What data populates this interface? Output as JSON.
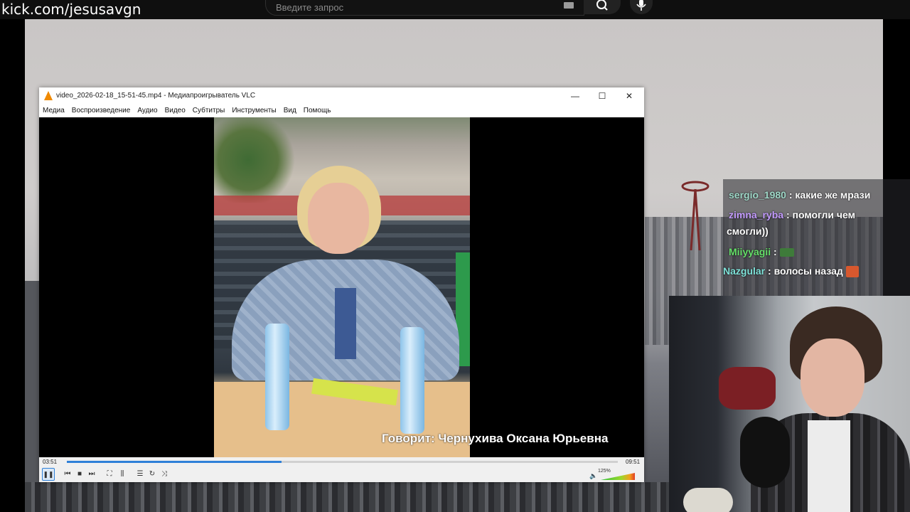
{
  "channel_url": "kick.com/jesusavgn",
  "search": {
    "placeholder": "Введите запрос"
  },
  "vlc": {
    "title": "video_2026-02-18_15-51-45.mp4 - Медиапроигрыватель VLC",
    "menu": [
      "Медиа",
      "Воспроизведение",
      "Аудио",
      "Видео",
      "Субтитры",
      "Инструменты",
      "Вид",
      "Помощь"
    ],
    "caption": "Говорит: Чернухива Оксана Юрьевна",
    "time_current": "03:51",
    "time_total": "09:51",
    "progress": 0.39,
    "volume": "125%",
    "window_buttons": {
      "minimize": "—",
      "maximize": "☐",
      "close": "✕"
    },
    "icons": {
      "play_pause": "pause-icon",
      "prev": "previous-icon",
      "stop": "stop-icon",
      "next": "next-icon",
      "fullscreen": "fullscreen-icon",
      "extended": "equalizer-icon",
      "playlist": "playlist-icon",
      "loop": "loop-icon",
      "shuffle": "shuffle-icon",
      "volume": "speaker-icon"
    },
    "accent_color": "#2f80d8"
  },
  "chat": [
    {
      "user": "sergio_1980",
      "color": "#9fd8c8",
      "text": ": какие же мрази"
    },
    {
      "user": "zimna_ryba",
      "color": "#c49cff",
      "text": ": помогли чем",
      "cont": "смогли))"
    },
    {
      "user": "Miiyyagii",
      "color": "#66e06a",
      "text": ":",
      "emote": "green-emote"
    },
    {
      "user": "Nazgular",
      "color": "#7fe2d9",
      "text": ": волосы назад",
      "emote": "orange-emote"
    }
  ]
}
